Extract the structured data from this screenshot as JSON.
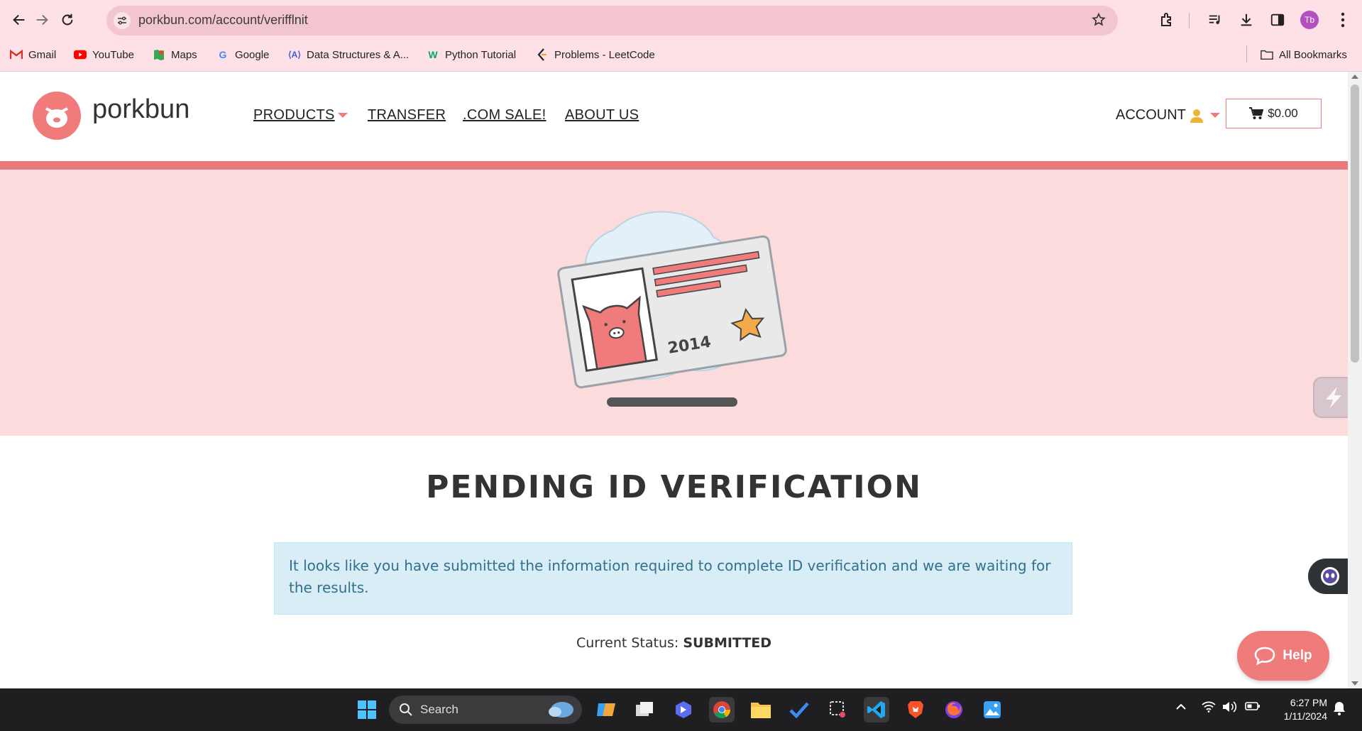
{
  "browser": {
    "url": "porkbun.com/account/verifflnit",
    "profile_initials": "Tb",
    "bookmarks": [
      {
        "label": "Gmail",
        "icon": "gmail-icon"
      },
      {
        "label": "YouTube",
        "icon": "youtube-icon"
      },
      {
        "label": "Maps",
        "icon": "maps-icon"
      },
      {
        "label": "Google",
        "icon": "google-icon"
      },
      {
        "label": "Data Structures & A...",
        "icon": "code-icon"
      },
      {
        "label": "Python Tutorial",
        "icon": "w3schools-icon"
      },
      {
        "label": "Problems - LeetCode",
        "icon": "leetcode-icon"
      }
    ],
    "all_bookmarks_label": "All Bookmarks"
  },
  "site": {
    "logo_text": "porkbun",
    "nav": {
      "products": "PRODUCTS",
      "transfer": "TRANSFER",
      "com_sale": ".COM SALE!",
      "about": "ABOUT US"
    },
    "account_label": "ACCOUNT",
    "cart_total": "$0.00",
    "accent_color": "#ef7b7b"
  },
  "hero": {
    "card_year": "2014"
  },
  "main": {
    "title": "PENDING ID VERIFICATION",
    "alert_text": "It looks like you have submitted the information required to complete ID verification and we are waiting for the results.",
    "status_label": "Current Status:",
    "status_value": "SUBMITTED"
  },
  "widgets": {
    "help_label": "Help"
  },
  "taskbar": {
    "search_placeholder": "Search",
    "time": "6:27 PM",
    "date": "1/11/2024"
  }
}
